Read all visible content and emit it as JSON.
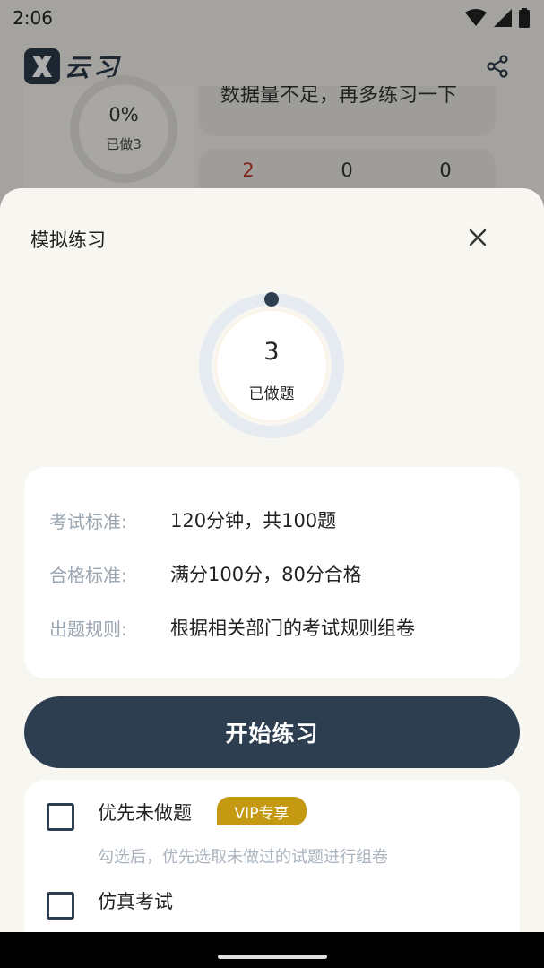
{
  "status_bar": {
    "time": "2:06"
  },
  "app": {
    "name": "云习",
    "logo_letter": "X"
  },
  "background": {
    "progress_percent": "0%",
    "done_label": "已做3",
    "message": "数据量不足，再多练习一下",
    "stats": [
      "2",
      "0",
      "0"
    ]
  },
  "sheet": {
    "title": "模拟练习",
    "done_count": "3",
    "done_label": "已做题",
    "info": [
      {
        "label": "考试标准:",
        "value": "120分钟，共100题"
      },
      {
        "label": "合格标准:",
        "value": "满分100分，80分合格"
      },
      {
        "label": "出题规则:",
        "value": "根据相关部门的考试规则组卷"
      }
    ],
    "start_button": "开始练习",
    "options": [
      {
        "label": "优先未做题",
        "badge": "VIP专享",
        "description": "勾选后，优先选取未做过的试题进行组卷"
      },
      {
        "label": "仿真考试"
      }
    ]
  },
  "colors": {
    "accent": "#2c3e50",
    "vip": "#c39a12",
    "stat_red": "#c0392b",
    "sheet_bg": "#f8f6f1"
  }
}
